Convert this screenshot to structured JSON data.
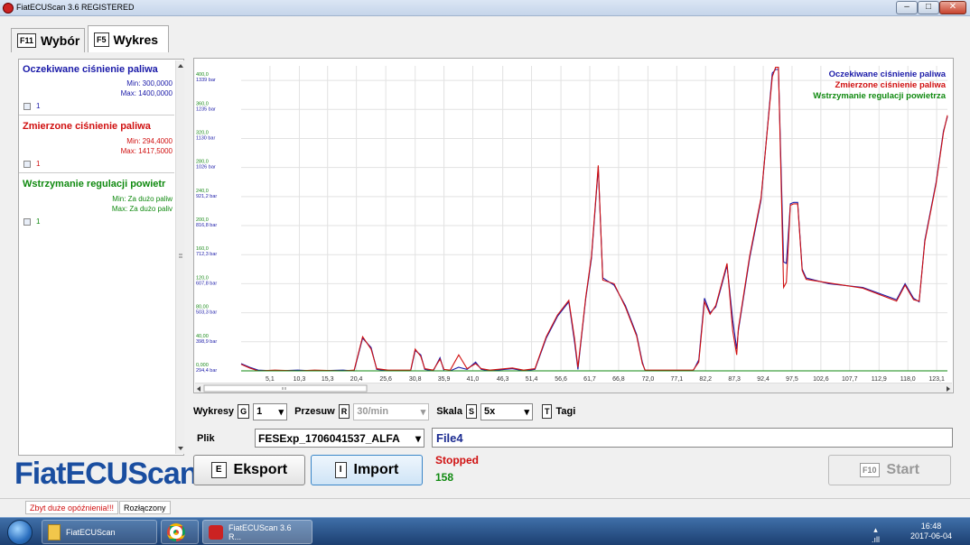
{
  "window": {
    "title": "FiatECUScan 3.6 REGISTERED",
    "min": "–",
    "max": "□",
    "close": "✕"
  },
  "tabs": [
    {
      "key": "F11",
      "label": "Wybór"
    },
    {
      "key": "F5",
      "label": "Wykres"
    }
  ],
  "sensors": [
    {
      "name": "Oczekiwane ciśnienie paliwa",
      "min": "Min: 300,0000",
      "max": "Max: 1400,0000",
      "checked_value": "1",
      "color": "#1a1aa8"
    },
    {
      "name": "Zmierzone ciśnienie paliwa",
      "min": "Min: 294,4000",
      "max": "Max: 1417,5000",
      "checked_value": "1",
      "color": "#d01010"
    },
    {
      "name": "Wstrzymanie regulacji powietr",
      "min": "Min: Za dużo paliw",
      "max": "Max: Za dużo paliv",
      "checked_value": "1",
      "color": "#108a10"
    }
  ],
  "logo": "FiatECUScan",
  "chart_data": {
    "type": "line",
    "x_ticks": [
      "5,1",
      "10,3",
      "15,3",
      "20,4",
      "25,6",
      "30,8",
      "35,9",
      "41,0",
      "46,3",
      "51,4",
      "56,6",
      "61,7",
      "66,8",
      "72,0",
      "77,1",
      "82,2",
      "87,3",
      "92,4",
      "97,5",
      "102,6",
      "107,7",
      "112,9",
      "118,0",
      "123,1"
    ],
    "y_ticks": [
      {
        "v": "0,000",
        "b": "294,4 bar"
      },
      {
        "v": "40,00",
        "b": "398,9 bar"
      },
      {
        "v": "80,00",
        "b": "503,3 bar"
      },
      {
        "v": "120,0",
        "b": "607,8 bar"
      },
      {
        "v": "160,0",
        "b": "712,3 bar"
      },
      {
        "v": "200,0",
        "b": "816,8 bar"
      },
      {
        "v": "240,0",
        "b": "921,2 bar"
      },
      {
        "v": "280,0",
        "b": "1026 bar"
      },
      {
        "v": "320,0",
        "b": "1130 bar"
      },
      {
        "v": "360,0",
        "b": "1235 bar"
      },
      {
        "v": "400,0",
        "b": "1339 bar"
      }
    ],
    "xlim": [
      0,
      125
    ],
    "ylim": [
      0,
      420
    ],
    "grid": true,
    "legend_position": "top-right",
    "series": [
      {
        "name": "Oczekiwane ciśnienie paliwa",
        "color": "#1a1aa8",
        "points": [
          [
            0,
            10
          ],
          [
            1.5,
            5
          ],
          [
            3,
            1
          ],
          [
            6,
            0
          ],
          [
            10,
            1
          ],
          [
            13,
            0
          ],
          [
            18,
            1
          ],
          [
            20,
            0
          ],
          [
            21.5,
            45
          ],
          [
            23,
            32
          ],
          [
            24,
            2
          ],
          [
            26,
            0
          ],
          [
            30,
            0
          ],
          [
            30.8,
            28
          ],
          [
            31.8,
            22
          ],
          [
            32.5,
            2
          ],
          [
            34,
            0
          ],
          [
            35.2,
            18
          ],
          [
            35.9,
            0
          ],
          [
            37,
            0
          ],
          [
            38.5,
            5
          ],
          [
            40,
            2
          ],
          [
            41.5,
            12
          ],
          [
            42.5,
            2
          ],
          [
            44,
            0
          ],
          [
            48,
            3
          ],
          [
            50,
            0
          ],
          [
            52,
            2
          ],
          [
            54,
            45
          ],
          [
            56,
            75
          ],
          [
            58,
            95
          ],
          [
            59,
            40
          ],
          [
            59.6,
            2
          ],
          [
            61,
            100
          ],
          [
            62,
            155
          ],
          [
            63.2,
            280
          ],
          [
            64,
            128
          ],
          [
            66,
            118
          ],
          [
            68,
            90
          ],
          [
            70,
            50
          ],
          [
            71,
            12
          ],
          [
            71.5,
            0
          ],
          [
            80,
            0
          ],
          [
            81,
            15
          ],
          [
            82,
            100
          ],
          [
            83,
            80
          ],
          [
            84,
            88
          ],
          [
            86,
            145
          ],
          [
            87,
            70
          ],
          [
            87.7,
            30
          ],
          [
            88,
            55
          ],
          [
            90,
            155
          ],
          [
            92,
            235
          ],
          [
            94,
            410
          ],
          [
            94.6,
            415
          ],
          [
            95.1,
            415
          ],
          [
            96,
            150
          ],
          [
            96.5,
            148
          ],
          [
            97.2,
            230
          ],
          [
            97.8,
            232
          ],
          [
            98.5,
            232
          ],
          [
            99.3,
            140
          ],
          [
            100,
            128
          ],
          [
            104,
            120
          ],
          [
            110,
            115
          ],
          [
            116,
            98
          ],
          [
            117.5,
            120
          ],
          [
            119,
            100
          ],
          [
            120,
            95
          ],
          [
            121,
            180
          ],
          [
            123,
            260
          ],
          [
            124.3,
            330
          ],
          [
            125,
            350
          ]
        ]
      },
      {
        "name": "Zmierzone ciśnienie paliwa",
        "color": "#d01010",
        "points": [
          [
            0,
            9
          ],
          [
            1.5,
            4
          ],
          [
            3,
            0
          ],
          [
            6,
            1
          ],
          [
            10,
            0
          ],
          [
            13,
            1
          ],
          [
            18,
            0
          ],
          [
            20,
            1
          ],
          [
            21.5,
            47
          ],
          [
            23,
            30
          ],
          [
            24,
            3
          ],
          [
            26,
            1
          ],
          [
            30,
            1
          ],
          [
            30.8,
            30
          ],
          [
            31.8,
            20
          ],
          [
            32.5,
            3
          ],
          [
            34,
            1
          ],
          [
            35.2,
            16
          ],
          [
            35.9,
            2
          ],
          [
            37,
            1
          ],
          [
            38.5,
            22
          ],
          [
            40,
            3
          ],
          [
            41.5,
            10
          ],
          [
            42.5,
            3
          ],
          [
            44,
            1
          ],
          [
            48,
            4
          ],
          [
            50,
            1
          ],
          [
            52,
            3
          ],
          [
            54,
            47
          ],
          [
            56,
            77
          ],
          [
            58,
            97
          ],
          [
            59,
            45
          ],
          [
            59.6,
            5
          ],
          [
            61,
            102
          ],
          [
            62,
            158
          ],
          [
            63.2,
            283
          ],
          [
            64,
            125
          ],
          [
            66,
            120
          ],
          [
            68,
            88
          ],
          [
            70,
            48
          ],
          [
            71,
            10
          ],
          [
            71.5,
            1
          ],
          [
            80,
            1
          ],
          [
            81,
            12
          ],
          [
            82,
            95
          ],
          [
            83,
            78
          ],
          [
            84,
            90
          ],
          [
            86,
            148
          ],
          [
            87,
            55
          ],
          [
            87.7,
            22
          ],
          [
            88,
            58
          ],
          [
            90,
            158
          ],
          [
            92,
            238
          ],
          [
            94,
            405
          ],
          [
            94.6,
            418
          ],
          [
            95.1,
            418
          ],
          [
            96,
            115
          ],
          [
            96.5,
            122
          ],
          [
            97.2,
            228
          ],
          [
            97.8,
            230
          ],
          [
            98.5,
            230
          ],
          [
            99.3,
            138
          ],
          [
            100,
            126
          ],
          [
            104,
            121
          ],
          [
            110,
            114
          ],
          [
            116,
            96
          ],
          [
            117.5,
            118
          ],
          [
            119,
            98
          ],
          [
            120,
            96
          ],
          [
            121,
            178
          ],
          [
            123,
            258
          ],
          [
            124.3,
            328
          ],
          [
            125,
            352
          ]
        ]
      },
      {
        "name": "Wstrzymanie regulacji powietrza",
        "color": "#108a10",
        "points": [
          [
            0,
            0
          ],
          [
            125,
            0
          ]
        ]
      }
    ]
  },
  "controls": {
    "wykresy_label": "Wykresy",
    "wykresy_key": "G",
    "wykresy_value": "1",
    "przesuw_label": "Przesuw",
    "przesuw_key": "R",
    "przesuw_value": "30/min",
    "skala_label": "Skala",
    "skala_key": "S",
    "skala_value": "5x",
    "tagi_key": "T",
    "tagi_label": "Tagi"
  },
  "file": {
    "label": "Plik",
    "value": "FESExp_1706041537_ALFA",
    "display": "File4"
  },
  "buttons": {
    "eksport_key": "E",
    "eksport": "Eksport",
    "import_key": "I",
    "import": "Import",
    "start_key": "F10",
    "start": "Start"
  },
  "status": {
    "state": "Stopped",
    "count": "158",
    "state_color": "#d01010",
    "count_color": "#108a10"
  },
  "statusbar": {
    "warning": "Zbyt duże opóźnienia!!!",
    "connection": "Rozłączony"
  },
  "taskbar": {
    "explorer": "FiatECUScan",
    "app": "FiatECUScan 3.6 R...",
    "time": "16:48",
    "date": "2017-06-04"
  }
}
